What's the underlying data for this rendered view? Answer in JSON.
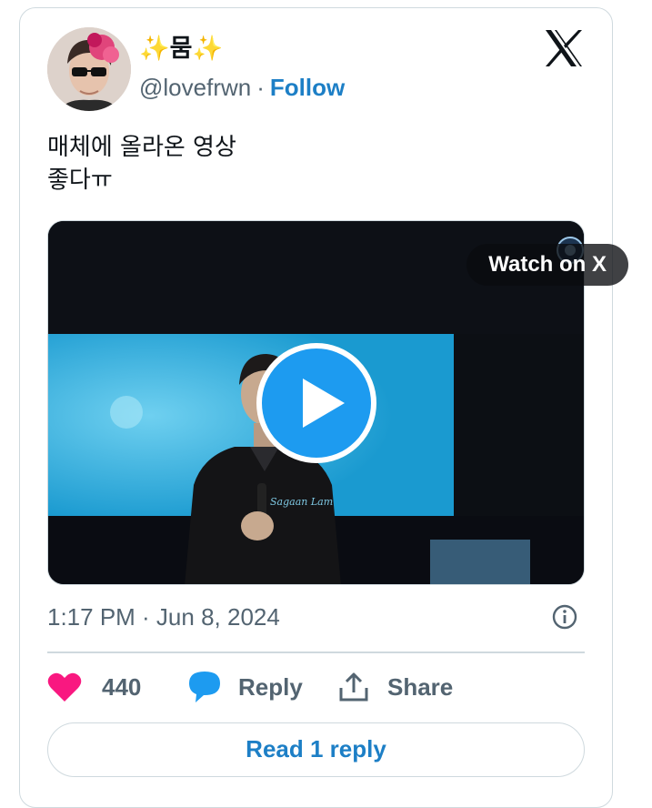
{
  "author": {
    "display_name": "✨뭄✨",
    "handle": "@lovefrwn",
    "separator": "·",
    "follow_label": "Follow"
  },
  "tweet": {
    "lines": [
      "매체에 올라온 영상",
      "좋다ㅠ"
    ],
    "timestamp": "1:17 PM · Jun 8, 2024"
  },
  "media": {
    "watch_label": "Watch on X",
    "screen_logo_text": "Sagaan Lam"
  },
  "actions": {
    "like_count": "440",
    "reply_label": "Reply",
    "share_label": "Share"
  },
  "read_replies_label": "Read 1 reply",
  "icons": {
    "brand": "x-logo-icon",
    "like": "heart-icon",
    "reply": "speech-bubble-icon",
    "share": "share-upload-icon",
    "info": "info-icon",
    "play": "play-icon"
  },
  "colors": {
    "like": "#f91880",
    "reply_icon": "#1d9bf0",
    "link": "#1d7fc6",
    "muted": "#536471",
    "border": "#cfd9de"
  }
}
